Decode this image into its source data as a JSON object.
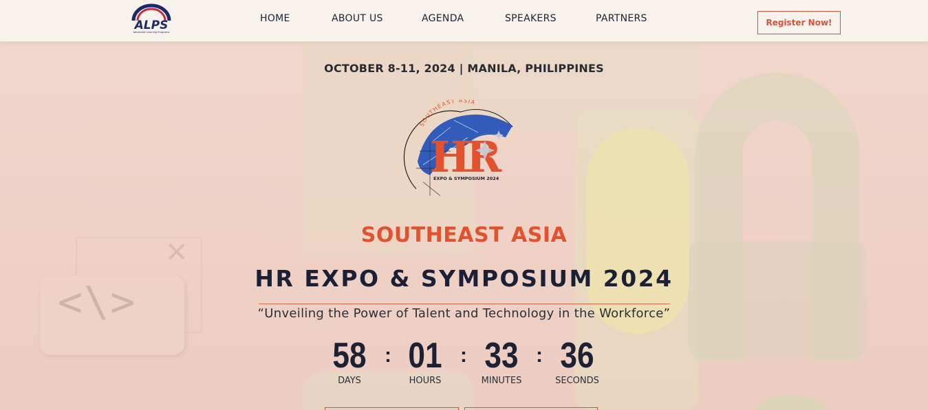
{
  "header": {
    "logo_text": "ALPS",
    "logo_subtext": "Advanced Learning Programs",
    "nav": [
      {
        "label": "HOME"
      },
      {
        "label": "ABOUT US"
      },
      {
        "label": "AGENDA"
      },
      {
        "label": "SPEAKERS"
      },
      {
        "label": "PARTNERS"
      }
    ],
    "register_label": "Register Now!"
  },
  "hero": {
    "date_location": "OCTOBER 8-11, 2024 | MANILA, PHILIPPINES",
    "logo": {
      "arc_text": "SOUTHEAST ASIA",
      "letters": "HR",
      "caption": "EXPO & SYMPOSIUM 2024"
    },
    "region": "SOUTHEAST ASIA",
    "title": "HR EXPO & SYMPOSIUM 2024",
    "tagline": "“Unveiling the Power of Talent and Technology in the Workforce”",
    "countdown": [
      {
        "value": "58",
        "label": "DAYS"
      },
      {
        "value": "01",
        "label": "HOURS"
      },
      {
        "value": "33",
        "label": "MINUTES"
      },
      {
        "value": "36",
        "label": "SECONDS"
      }
    ],
    "separator": ":"
  },
  "colors": {
    "accent": "#e2522f",
    "navy": "#1a2035",
    "header_bg": "#f7f2ec",
    "hero_bg": "#f0d6cb"
  }
}
